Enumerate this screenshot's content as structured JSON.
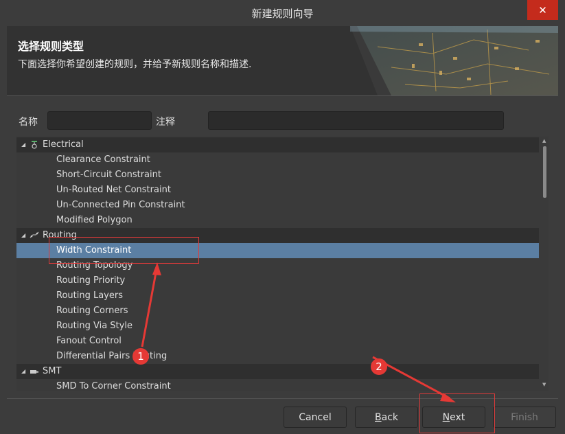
{
  "window": {
    "title": "新建规则向导"
  },
  "icons": {
    "close": "close-icon",
    "electrical": "electrical-icon",
    "routing": "routing-icon",
    "smt": "smt-icon"
  },
  "header": {
    "title": "选择规则类型",
    "subtitle": "下面选择你希望创建的规则，并给予新规则名称和描述."
  },
  "form": {
    "name_label": "名称",
    "name_value": "",
    "comment_label": "注释",
    "comment_value": ""
  },
  "tree": {
    "electrical": {
      "label": "Electrical",
      "items": [
        "Clearance Constraint",
        "Short-Circuit Constraint",
        "Un-Routed Net Constraint",
        "Un-Connected Pin Constraint",
        "Modified Polygon"
      ]
    },
    "routing": {
      "label": "Routing",
      "selected": "Width Constraint",
      "items": [
        "Routing Topology",
        "Routing Priority",
        "Routing Layers",
        "Routing Corners",
        "Routing Via Style",
        "Fanout Control",
        "Differential Pairs Routing"
      ]
    },
    "smt": {
      "label": "SMT",
      "items": [
        "SMD To Corner Constraint"
      ]
    }
  },
  "buttons": {
    "cancel": "Cancel",
    "back_u": "B",
    "back_rest": "ack",
    "next_u": "N",
    "next_rest": "ext",
    "finish": "Finish"
  },
  "annotations": {
    "step1": "1",
    "step2": "2"
  },
  "colors": {
    "selection": "#5b7fa3",
    "annotation": "#e53935",
    "close_button": "#c42b1c"
  }
}
